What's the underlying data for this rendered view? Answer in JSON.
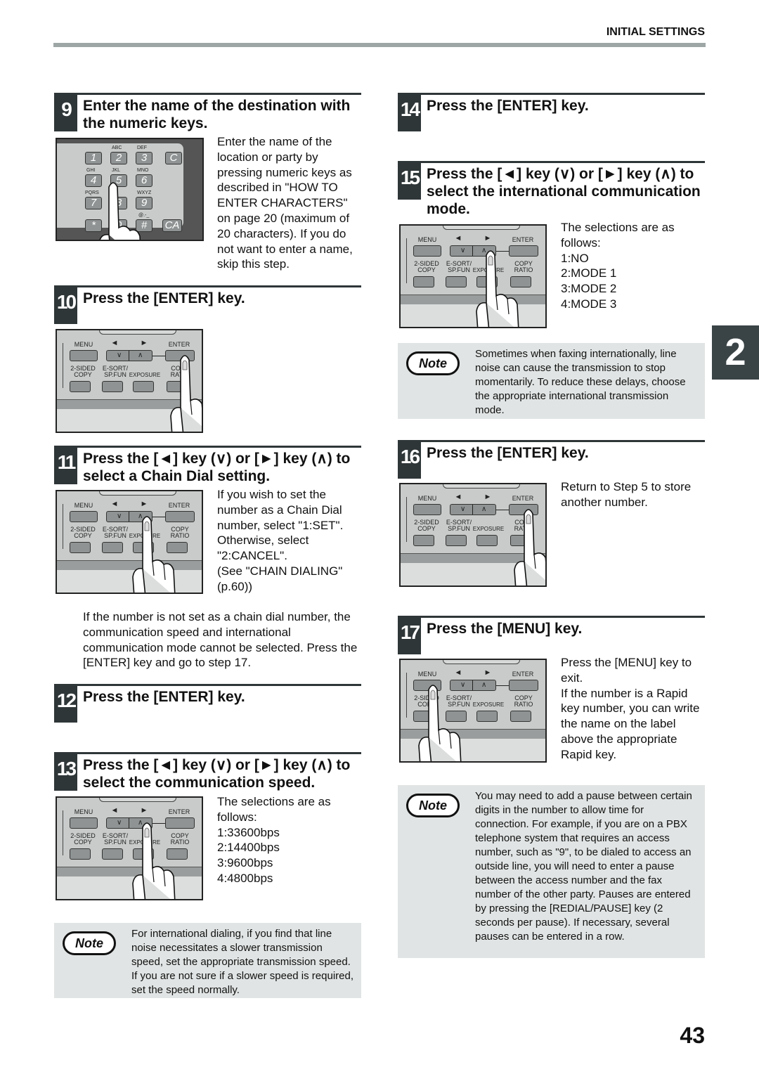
{
  "header": {
    "section": "INITIAL SETTINGS"
  },
  "page_number": "43",
  "chapter_tab": "2",
  "panel": {
    "menu": "MENU",
    "left": "◄",
    "right": "►",
    "enter": "ENTER",
    "down": "∨",
    "up": "∧",
    "two_sided": "2-SIDED",
    "copy": "COPY",
    "esort": "E-SORT/",
    "spfun": "SP.FUN",
    "exposure": "EXPOSURE",
    "copy2": "COPY",
    "ratio": "RATIO"
  },
  "keypad": {
    "keys": [
      "1",
      "2",
      "3",
      "C",
      "4",
      "5",
      "6",
      "7",
      "8",
      "9",
      "*",
      "0",
      "#",
      "CA"
    ],
    "letters": [
      "ABC",
      "DEF",
      "GHI",
      "JKL",
      "MNO",
      "PQRS",
      "WXYZ",
      "@.-_"
    ]
  },
  "note_label": "Note",
  "steps": {
    "s9": {
      "num": "9",
      "title": "Enter the name of the destination with the numeric keys.",
      "text": "Enter the name of the location or party by pressing numeric keys as described in \"HOW TO ENTER CHARACTERS\" on page 20 (maximum of 20 characters). If you do not want to enter a name, skip this step."
    },
    "s10": {
      "num": "10",
      "title": "Press the [ENTER] key."
    },
    "s11": {
      "num": "11",
      "title": "Press the [◄] key (∨) or [►] key (∧) to select a Chain Dial setting.",
      "text": "If you wish to set the number as a Chain Dial number, select \"1:SET\". Otherwise, select \"2:CANCEL\".",
      "text2": "(See \"CHAIN DIALING\" (p.60))",
      "after": "If the number is not set as a chain dial number, the communication speed and international communication mode cannot be selected. Press the [ENTER] key and go to step 17."
    },
    "s12": {
      "num": "12",
      "title": "Press the [ENTER] key."
    },
    "s13": {
      "num": "13",
      "title": "Press the [◄] key (∨) or [►] key (∧) to select the communication speed.",
      "text": "The selections are as follows:",
      "options": [
        "1:33600bps",
        "2:14400bps",
        "3:9600bps",
        "4:4800bps"
      ],
      "note": "For international dialing, if you find that line noise necessitates a slower transmission speed, set the appropriate transmission speed. If you are not sure if a slower speed is required, set the speed normally."
    },
    "s14": {
      "num": "14",
      "title": "Press the [ENTER] key."
    },
    "s15": {
      "num": "15",
      "title": "Press the [◄] key (∨) or [►] key (∧) to select the international communication mode.",
      "text": "The selections are as follows:",
      "options": [
        "1:NO",
        "2:MODE 1",
        "3:MODE 2",
        "4:MODE 3"
      ],
      "note": "Sometimes when faxing internationally, line noise can cause the transmission to stop momentarily. To reduce these delays, choose the appropriate international transmission mode."
    },
    "s16": {
      "num": "16",
      "title": "Press the [ENTER] key.",
      "text": "Return to Step 5 to store another number."
    },
    "s17": {
      "num": "17",
      "title": "Press the [MENU] key.",
      "text": "Press the [MENU] key to exit.",
      "text2": "If the number is a Rapid key number, you can write the name on the label above the appropriate Rapid key.",
      "note": "You may need to add a pause between certain digits in the number to allow time for connection. For example, if you are on a PBX telephone system that requires an access number, such as \"9\", to be dialed to access an outside line, you will need to enter a pause between the access number and the fax number of the other party. Pauses are entered by pressing the [REDIAL/PAUSE] key (2 seconds per pause). If necessary, several pauses can be entered in a row."
    }
  }
}
